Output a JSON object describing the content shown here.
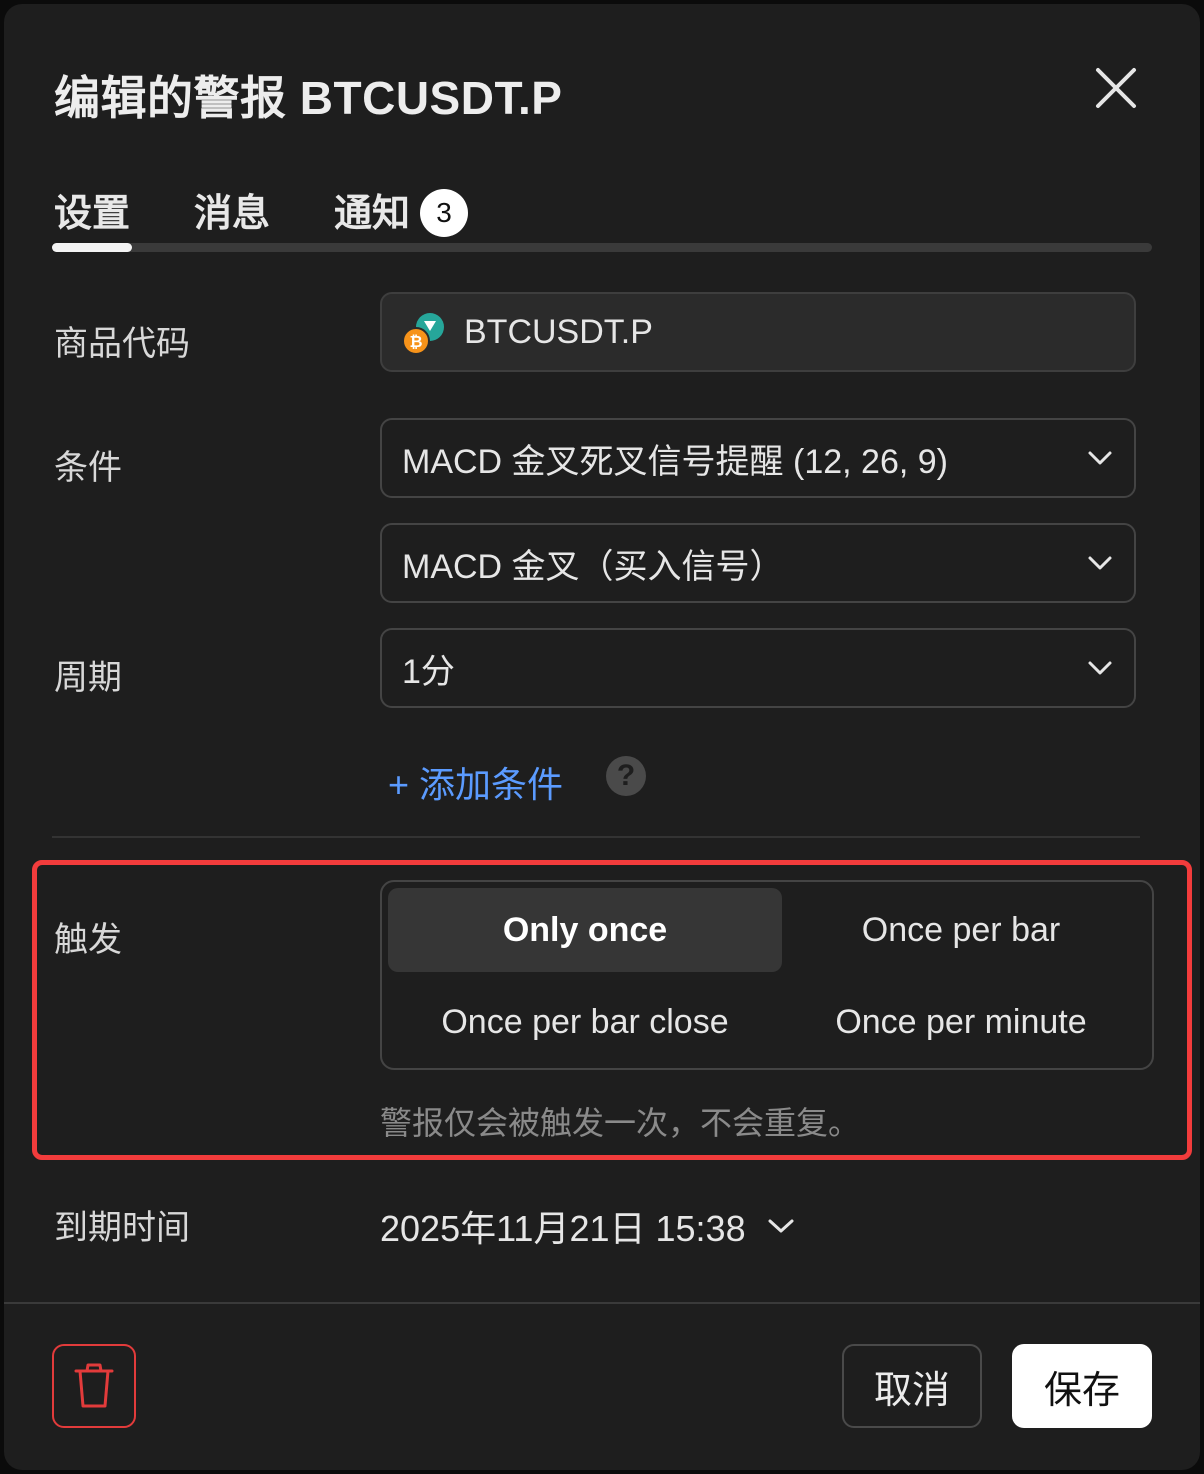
{
  "dialog": {
    "title": "编辑的警报 BTCUSDT.P",
    "close_icon": "close-icon"
  },
  "tabs": [
    {
      "label": "设置",
      "active": true
    },
    {
      "label": "消息",
      "active": false
    },
    {
      "label": "通知",
      "badge": "3",
      "active": false
    }
  ],
  "symbol": {
    "label": "商品代码",
    "value": "BTCUSDT.P",
    "icon": "coin-icon"
  },
  "condition": {
    "label": "条件",
    "primary": "MACD 金叉死叉信号提醒 (12, 26, 9)",
    "secondary": "MACD 金叉（买入信号）"
  },
  "period": {
    "label": "周期",
    "value": "1分"
  },
  "add_condition": {
    "label": "+ 添加条件",
    "help": "?"
  },
  "trigger": {
    "label": "触发",
    "options": [
      "Only once",
      "Once per bar",
      "Once per bar close",
      "Once per minute"
    ],
    "selected": "Only once",
    "hint": "警报仅会被触发一次，不会重复。"
  },
  "expiry": {
    "label": "到期时间",
    "value": "2025年11月21日 15:38"
  },
  "footer": {
    "cancel": "取消",
    "save": "保存",
    "delete_icon": "trash-icon"
  },
  "colors": {
    "accent": "#5b9bff",
    "highlight": "#f23c3c",
    "danger": "#e23b3b",
    "background": "#1e1e1e"
  }
}
